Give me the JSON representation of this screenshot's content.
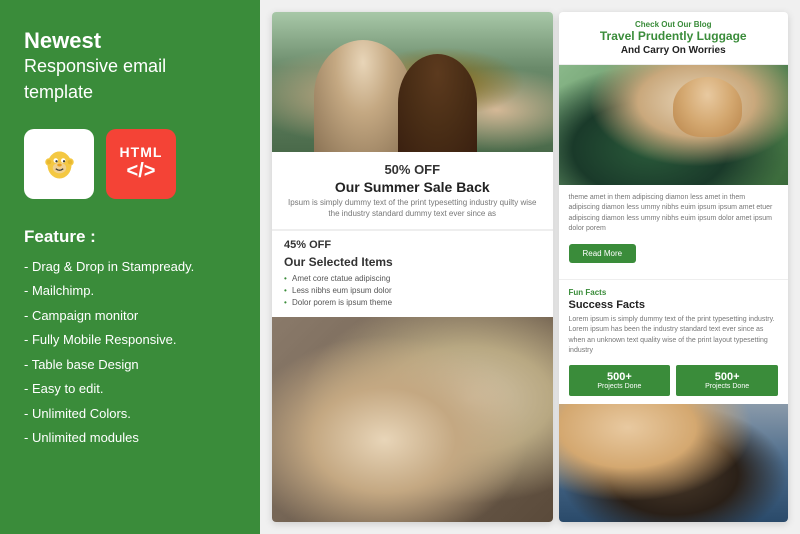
{
  "left": {
    "title_new": "Newest",
    "title_sub": "Responsive email template",
    "badge_html_text": "HTML",
    "badge_html_code": "</>",
    "feature_title": "Feature :",
    "features": [
      "- Drag & Drop in Stampready.",
      "- Mailchimp.",
      "- Campaign monitor",
      "- Fully Mobile Responsive.",
      "- Table base Design",
      "- Easy to edit.",
      "- Unlimited Colors.",
      "- Unlimited modules"
    ]
  },
  "email_left": {
    "sale_percent": "50% OFF",
    "sale_title": "Our Summer Sale Back",
    "sale_text": "Ipsum is simply dummy text of the print typesetting industry quilty wise the industry standard dummy text ever since as",
    "selected_percent": "45% OFF",
    "selected_title": "Our Selected Items",
    "selected_items": [
      "Amet core ctatue adipiscing",
      "Less nibhs eum ipsum dolor",
      "Dolor porem is ipsum theme"
    ]
  },
  "email_right": {
    "check_blog": "Check Out Our Blog",
    "blog_title": "Travel Prudently Luggage",
    "blog_subtitle": "And Carry On Worries",
    "blog_body": "theme amet in them adipiscing diamon less amet in them adipiscing diamon less ummy nibhs euim ipsum ipsum amet etuer adipiscing diamon less ummy nibhs euim ipsum dolor amet ipsum dolor porem",
    "read_more": "Read More",
    "fun_facts_label": "Fun Facts",
    "fun_facts_title": "Success Facts",
    "fun_facts_text": "Lorem ipsum is simply dummy text of the print typesetting industry. Lorem ipsum has been the industry standard text ever since as when an unknown text quality wise of the print layout typesetting industry",
    "stat1_number": "500+",
    "stat1_label": "Projects Done",
    "stat2_number": "500+",
    "stat2_label": "Projects Done"
  }
}
